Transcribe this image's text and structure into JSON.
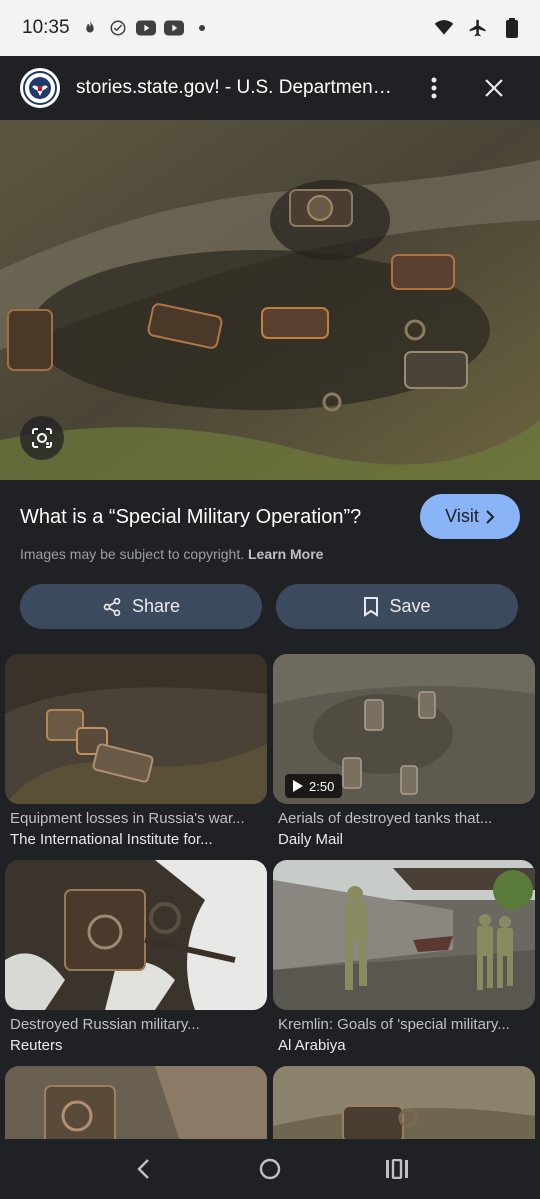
{
  "status_bar": {
    "time": "10:35",
    "left_icons": [
      "flame-icon",
      "check-circle-icon",
      "youtube-icon",
      "youtube-icon",
      "dot-icon"
    ],
    "right_icons": [
      "wifi-icon",
      "airplane-icon",
      "battery-icon"
    ]
  },
  "header": {
    "site_title": "stories.state.gov! - U.S. Department o...",
    "logo_icon": "state-department-seal-icon",
    "more_icon": "more-vert-icon",
    "close_icon": "close-icon"
  },
  "hero": {
    "lens_icon": "google-lens-icon"
  },
  "info": {
    "heading": "What is a “Special Military Operation”?",
    "visit_label": "Visit",
    "copyright_text": "Images may be subject to copyright.",
    "learn_more": "Learn More",
    "share_label": "Share",
    "save_label": "Save"
  },
  "results": [
    {
      "title": "Equipment losses in Russia's war...",
      "source": "The International Institute for...",
      "duration": ""
    },
    {
      "title": "Aerials of destroyed tanks that...",
      "source": "Daily Mail",
      "duration": "2:50"
    },
    {
      "title": "Destroyed Russian military...",
      "source": "Reuters",
      "duration": ""
    },
    {
      "title": "Kremlin: Goals of 'special military...",
      "source": "Al Arabiya",
      "duration": ""
    },
    {
      "title": "",
      "source": "",
      "duration": ""
    },
    {
      "title": "",
      "source": "",
      "duration": ""
    }
  ],
  "colors": {
    "background": "#202124",
    "accent": "#8ab4f8",
    "button_bg": "#3c4a5e",
    "status_bar_bg": "#f1f3f4"
  }
}
